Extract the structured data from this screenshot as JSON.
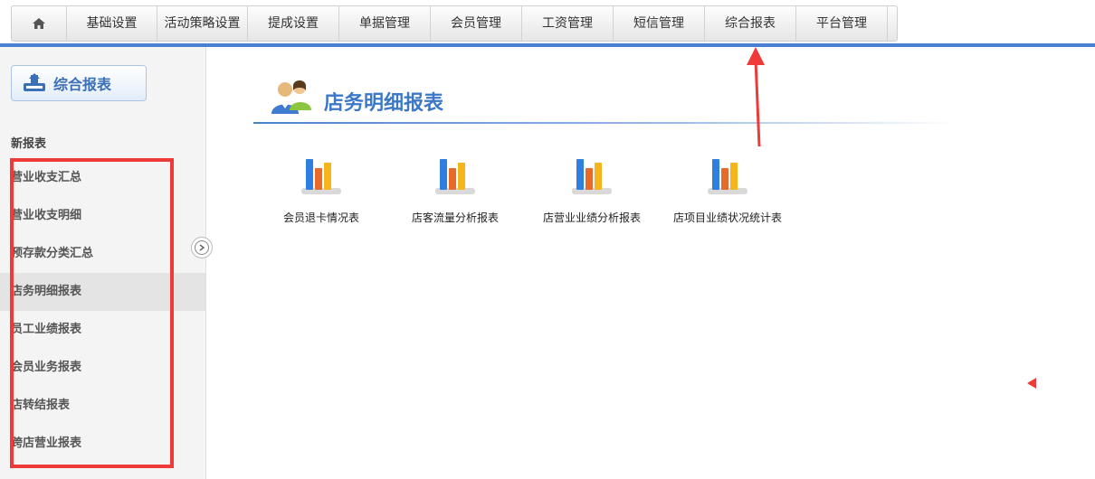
{
  "topnav": {
    "items": [
      "基础设置",
      "活动策略设置",
      "提成设置",
      "单据管理",
      "会员管理",
      "工资管理",
      "短信管理",
      "综合报表",
      "平台管理"
    ]
  },
  "sidebar": {
    "button_label": "综合报表",
    "heading": "新报表",
    "items": [
      "营业收支汇总",
      "营业收支明细",
      "预存款分类汇总",
      "店务明细报表",
      "员工业绩报表",
      "会员业务报表",
      "店转结报表",
      "跨店营业报表"
    ],
    "active_index": 3
  },
  "main": {
    "title": "店务明细报表",
    "reports": [
      "会员退卡情况表",
      "店客流量分析报表",
      "店营业业绩分析报表",
      "店项目业绩状况统计表"
    ]
  },
  "colors": {
    "accent": "#4a7fd1",
    "title": "#3b78c8",
    "annotation": "#ef3a3a"
  }
}
